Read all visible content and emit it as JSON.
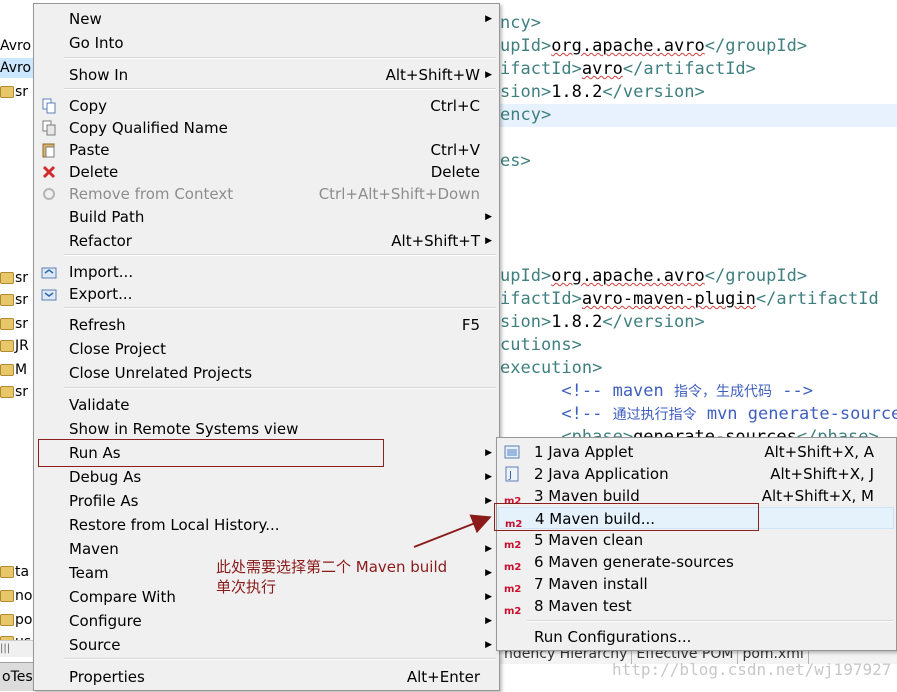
{
  "explorer": {
    "rows": [
      "Avro",
      "Avro",
      "sr",
      "",
      "",
      "",
      "",
      "",
      "",
      "",
      "",
      "sr",
      "sr",
      "sr",
      "JR",
      "M",
      "sr",
      "",
      "",
      "",
      "",
      "",
      "",
      "",
      "",
      "ta",
      "no",
      "po",
      "us"
    ],
    "tab_label": "oTes"
  },
  "editor": {
    "lines": [
      {
        "parts": [
          {
            "t": "tag",
            "v": "ncy>"
          }
        ]
      },
      {
        "parts": [
          {
            "t": "tag",
            "v": "upId>"
          },
          {
            "t": "text",
            "v": "org.apache.avro"
          },
          {
            "t": "tag",
            "v": "</groupId>"
          }
        ]
      },
      {
        "parts": [
          {
            "t": "tag",
            "v": "ifactId>"
          },
          {
            "t": "text",
            "v": "avro"
          },
          {
            "t": "tag",
            "v": "</artifactId>"
          }
        ]
      },
      {
        "parts": [
          {
            "t": "tag",
            "v": "sion>"
          },
          {
            "t": "text",
            "v": "1.8.2"
          },
          {
            "t": "tag",
            "v": "</version>"
          }
        ]
      },
      {
        "parts": [
          {
            "t": "tag",
            "v": "ency>"
          }
        ],
        "highlight": true
      },
      {
        "parts": []
      },
      {
        "parts": [
          {
            "t": "tag",
            "v": "es>"
          }
        ]
      },
      {
        "parts": []
      },
      {
        "parts": []
      },
      {
        "parts": []
      },
      {
        "parts": []
      },
      {
        "parts": [
          {
            "t": "tag",
            "v": "upId>"
          },
          {
            "t": "text",
            "v": "org.apache.avro"
          },
          {
            "t": "tag",
            "v": "</groupId>"
          }
        ]
      },
      {
        "parts": [
          {
            "t": "tag",
            "v": "ifactId>"
          },
          {
            "t": "text",
            "v": "avro-maven-plugin"
          },
          {
            "t": "tag",
            "v": "</artifactId"
          }
        ]
      },
      {
        "parts": [
          {
            "t": "tag",
            "v": "sion>"
          },
          {
            "t": "text",
            "v": "1.8.2"
          },
          {
            "t": "tag",
            "v": "</version>"
          }
        ]
      },
      {
        "parts": [
          {
            "t": "tag",
            "v": "cutions>"
          }
        ]
      },
      {
        "parts": [
          {
            "t": "tag",
            "v": "execution>"
          }
        ]
      },
      {
        "parts": [
          {
            "t": "cmt",
            "v": "      <!-- maven "
          },
          {
            "t": "cmtcn",
            "v": "指令，生成代码"
          },
          {
            "t": "cmt",
            "v": " -->"
          }
        ]
      },
      {
        "parts": [
          {
            "t": "cmt",
            "v": "      <!-- "
          },
          {
            "t": "cmtcn",
            "v": "通过执行指令"
          },
          {
            "t": "cmt",
            "v": " mvn generate-source"
          }
        ]
      },
      {
        "parts": [
          {
            "t": "tag",
            "v": "      <phase>"
          },
          {
            "t": "text",
            "v": "generate-sources"
          },
          {
            "t": "tag",
            "v": "</phase>"
          }
        ]
      }
    ],
    "bottom_tabs": [
      "ndency Hierarchy",
      "Effective POM",
      "pom.xml"
    ],
    "watermark": "http://blog.csdn.net/wj197927"
  },
  "context_menu": {
    "items": [
      {
        "label": "New",
        "shortcut": "",
        "submenu": true,
        "icon": "new-icon"
      },
      {
        "label": "Go Into",
        "shortcut": "",
        "submenu": false,
        "icon": ""
      },
      {
        "label": "Show In",
        "shortcut": "Alt+Shift+W",
        "submenu": true,
        "icon": ""
      },
      {
        "label": "Copy",
        "shortcut": "Ctrl+C",
        "submenu": false,
        "icon": "copy-icon"
      },
      {
        "label": "Copy Qualified Name",
        "shortcut": "",
        "submenu": false,
        "icon": "copy-qualified-name-icon"
      },
      {
        "label": "Paste",
        "shortcut": "Ctrl+V",
        "submenu": false,
        "icon": "paste-icon"
      },
      {
        "label": "Delete",
        "shortcut": "Delete",
        "submenu": false,
        "icon": "delete-icon"
      },
      {
        "label": "Remove from Context",
        "shortcut": "Ctrl+Alt+Shift+Down",
        "submenu": false,
        "icon": "remove-context-icon",
        "disabled": true
      },
      {
        "label": "Build Path",
        "shortcut": "",
        "submenu": true,
        "icon": ""
      },
      {
        "label": "Refactor",
        "shortcut": "Alt+Shift+T",
        "submenu": true,
        "icon": ""
      },
      {
        "label": "Import...",
        "shortcut": "",
        "submenu": false,
        "icon": "import-icon"
      },
      {
        "label": "Export...",
        "shortcut": "",
        "submenu": false,
        "icon": "export-icon"
      },
      {
        "label": "Refresh",
        "shortcut": "F5",
        "submenu": false,
        "icon": ""
      },
      {
        "label": "Close Project",
        "shortcut": "",
        "submenu": false,
        "icon": ""
      },
      {
        "label": "Close Unrelated Projects",
        "shortcut": "",
        "submenu": false,
        "icon": ""
      },
      {
        "label": "Validate",
        "shortcut": "",
        "submenu": false,
        "icon": ""
      },
      {
        "label": "Show in Remote Systems view",
        "shortcut": "",
        "submenu": false,
        "icon": ""
      },
      {
        "label": "Run As",
        "shortcut": "",
        "submenu": true,
        "icon": ""
      },
      {
        "label": "Debug As",
        "shortcut": "",
        "submenu": true,
        "icon": ""
      },
      {
        "label": "Profile As",
        "shortcut": "",
        "submenu": true,
        "icon": ""
      },
      {
        "label": "Restore from Local History...",
        "shortcut": "",
        "submenu": false,
        "icon": ""
      },
      {
        "label": "Maven",
        "shortcut": "",
        "submenu": true,
        "icon": ""
      },
      {
        "label": "Team",
        "shortcut": "",
        "submenu": true,
        "icon": ""
      },
      {
        "label": "Compare With",
        "shortcut": "",
        "submenu": true,
        "icon": ""
      },
      {
        "label": "Configure",
        "shortcut": "",
        "submenu": true,
        "icon": ""
      },
      {
        "label": "Source",
        "shortcut": "",
        "submenu": true,
        "icon": ""
      },
      {
        "label": "Properties",
        "shortcut": "Alt+Enter",
        "submenu": false,
        "icon": ""
      }
    ]
  },
  "run_as_submenu": {
    "items": [
      {
        "label": "1 Java Applet",
        "shortcut": "Alt+Shift+X, A",
        "icon": "java-applet-icon"
      },
      {
        "label": "2 Java Application",
        "shortcut": "Alt+Shift+X, J",
        "icon": "java-application-icon"
      },
      {
        "label": "3 Maven build",
        "shortcut": "Alt+Shift+X, M",
        "icon": "maven-m2-icon"
      },
      {
        "label": "4 Maven build...",
        "shortcut": "",
        "icon": "maven-m2-icon",
        "hover": true
      },
      {
        "label": "5 Maven clean",
        "shortcut": "",
        "icon": "maven-m2-icon"
      },
      {
        "label": "6 Maven generate-sources",
        "shortcut": "",
        "icon": "maven-m2-icon"
      },
      {
        "label": "7 Maven install",
        "shortcut": "",
        "icon": "maven-m2-icon"
      },
      {
        "label": "8 Maven test",
        "shortcut": "",
        "icon": "maven-m2-icon"
      },
      {
        "label": "Run Configurations...",
        "shortcut": "",
        "icon": ""
      }
    ],
    "m2_text": "m2"
  },
  "annotation": {
    "line1": "此处需要选择第二个 Maven build",
    "line2": "单次执行"
  },
  "colors": {
    "menu_bg": "#f0f0f0",
    "highlight_border": "#8b2020",
    "hover_bg": "#e5f1fb",
    "annotation": "#8b1a1a",
    "xml_tag": "#3f7f7f",
    "xml_comment": "#3f5fbf",
    "m2_red": "#c8102e"
  }
}
